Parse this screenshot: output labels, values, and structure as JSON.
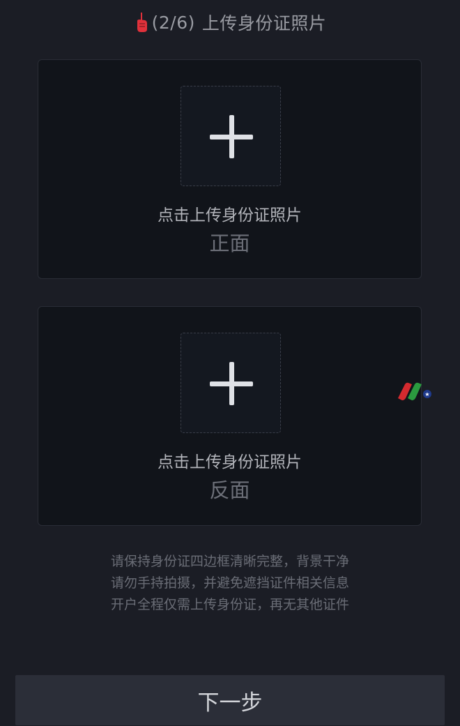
{
  "header": {
    "step": "(2/6)",
    "title": "上传身份证照片",
    "icon": "pointing-hand-icon",
    "icon_color": "#e0313b"
  },
  "cards": [
    {
      "icon": "plus-icon",
      "label": "点击上传身份证照片",
      "side": "正面"
    },
    {
      "icon": "plus-icon",
      "label": "点击上传身份证照片",
      "side": "反面"
    }
  ],
  "tips": [
    "请保持身份证四边框清晰完整，背景干净",
    "请勿手持拍摄，并避免遮挡证件相关信息",
    "开户全程仅需上传身份证，再无其他证件"
  ],
  "next_button": {
    "label": "下一步"
  },
  "colors": {
    "background": "#1b1d25",
    "card": "#11141a",
    "button": "#2b2e38"
  }
}
